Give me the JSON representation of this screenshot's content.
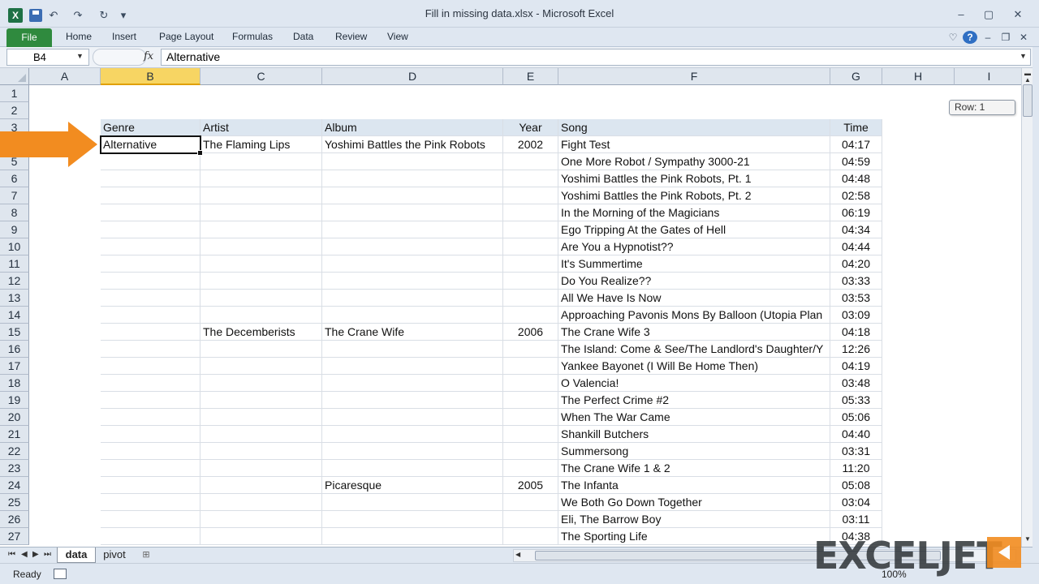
{
  "window": {
    "title": "Fill in missing data.xlsx  -  Microsoft Excel",
    "app_icon": "X"
  },
  "ribbon": {
    "file_tab": "File",
    "tabs": [
      "Home",
      "Insert",
      "Page Layout",
      "Formulas",
      "Data",
      "Review",
      "View"
    ]
  },
  "formula_bar": {
    "name_box": "B4",
    "fx_label": "fx",
    "value": "Alternative"
  },
  "columns": [
    "A",
    "B",
    "C",
    "D",
    "E",
    "F",
    "G",
    "H",
    "I"
  ],
  "selected_cell": "B4",
  "row_numbers": [
    "1",
    "2",
    "3",
    "4",
    "5",
    "6",
    "7",
    "8",
    "9",
    "10",
    "11",
    "12",
    "13",
    "14",
    "15",
    "16",
    "17",
    "18",
    "19",
    "20",
    "21",
    "22",
    "23",
    "24",
    "25",
    "26",
    "27"
  ],
  "table": {
    "headers": [
      "Genre",
      "Artist",
      "Album",
      "Year",
      "Song",
      "Time"
    ],
    "rows": [
      [
        "Alternative",
        "The Flaming Lips",
        "Yoshimi Battles the Pink Robots",
        "2002",
        "Fight Test",
        "04:17"
      ],
      [
        "",
        "",
        "",
        "",
        "One More Robot / Sympathy 3000-21",
        "04:59"
      ],
      [
        "",
        "",
        "",
        "",
        "Yoshimi Battles the Pink Robots, Pt. 1",
        "04:48"
      ],
      [
        "",
        "",
        "",
        "",
        "Yoshimi Battles the Pink Robots, Pt. 2",
        "02:58"
      ],
      [
        "",
        "",
        "",
        "",
        "In the Morning of the Magicians",
        "06:19"
      ],
      [
        "",
        "",
        "",
        "",
        "Ego Tripping At the Gates of Hell",
        "04:34"
      ],
      [
        "",
        "",
        "",
        "",
        "Are You a Hypnotist??",
        "04:44"
      ],
      [
        "",
        "",
        "",
        "",
        "It's Summertime",
        "04:20"
      ],
      [
        "",
        "",
        "",
        "",
        "Do You Realize??",
        "03:33"
      ],
      [
        "",
        "",
        "",
        "",
        "All We Have Is Now",
        "03:53"
      ],
      [
        "",
        "",
        "",
        "",
        "Approaching Pavonis Mons By Balloon (Utopia Plan",
        "03:09"
      ],
      [
        "",
        "The Decemberists",
        "The Crane Wife",
        "2006",
        "The Crane Wife 3",
        "04:18"
      ],
      [
        "",
        "",
        "",
        "",
        "The Island: Come & See/The Landlord's Daughter/Y",
        "12:26"
      ],
      [
        "",
        "",
        "",
        "",
        "Yankee Bayonet (I Will Be Home Then)",
        "04:19"
      ],
      [
        "",
        "",
        "",
        "",
        "O Valencia!",
        "03:48"
      ],
      [
        "",
        "",
        "",
        "",
        "The Perfect Crime #2",
        "05:33"
      ],
      [
        "",
        "",
        "",
        "",
        "When The War Came",
        "05:06"
      ],
      [
        "",
        "",
        "",
        "",
        "Shankill Butchers",
        "04:40"
      ],
      [
        "",
        "",
        "",
        "",
        "Summersong",
        "03:31"
      ],
      [
        "",
        "",
        "",
        "",
        "The Crane Wife 1 & 2",
        "11:20"
      ],
      [
        "",
        "",
        "Picaresque",
        "2005",
        "The Infanta",
        "05:08"
      ],
      [
        "",
        "",
        "",
        "",
        "We Both Go Down Together",
        "03:04"
      ],
      [
        "",
        "",
        "",
        "",
        "Eli, The Barrow Boy",
        "03:11"
      ],
      [
        "",
        "",
        "",
        "",
        "The Sporting Life",
        "04:38"
      ]
    ]
  },
  "row_tooltip": "Row: 1",
  "sheet_tabs": [
    "data",
    "pivot"
  ],
  "status": {
    "ready": "Ready",
    "zoom": "100%"
  },
  "watermark": "EXCELJET",
  "colors": {
    "selected_header": "#f7d563",
    "table_header_fill": "#dce6f0",
    "arrow": "#f28c20",
    "file_tab": "#2f8a3e"
  }
}
